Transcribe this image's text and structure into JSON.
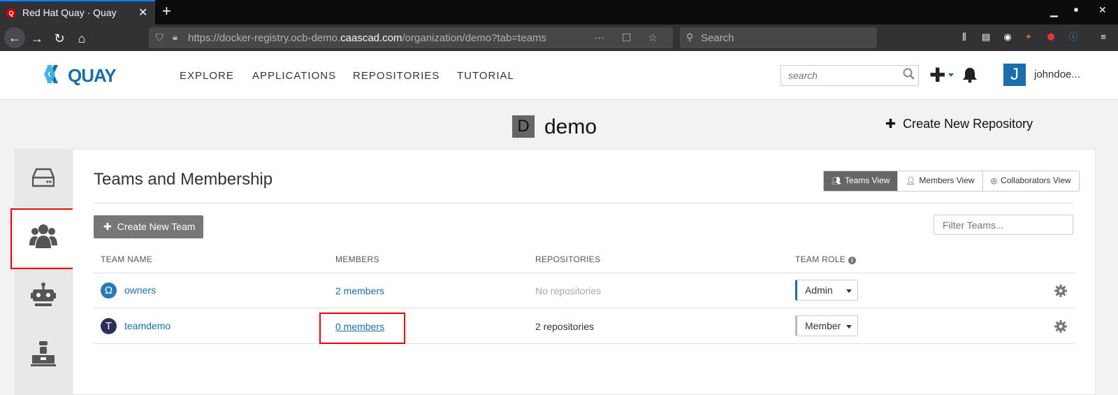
{
  "browser": {
    "tab_title": "Red Hat Quay · Quay",
    "url_prefix": "https://docker-registry.ocb-demo.",
    "url_domain": "caascad.com",
    "url_path": "/organization/demo?tab=teams",
    "search_placeholder": "Search",
    "favicon_letter": "Q"
  },
  "header": {
    "logo_text": "QUAY",
    "nav": [
      "EXPLORE",
      "APPLICATIONS",
      "REPOSITORIES",
      "TUTORIAL"
    ],
    "search_placeholder": "search",
    "user_initial": "J",
    "username": "johndoe..."
  },
  "org": {
    "initial": "D",
    "name": "demo",
    "create_repo_label": "Create New Repository"
  },
  "side_tabs": [
    "repositories-icon",
    "teams-icon",
    "robot-icon",
    "admin-icon"
  ],
  "panel": {
    "title": "Teams and Membership",
    "views": [
      {
        "label": "Teams View",
        "active": true
      },
      {
        "label": "Members View",
        "active": false
      },
      {
        "label": "Collaborators View",
        "active": false
      }
    ],
    "create_team_label": "Create New Team",
    "filter_placeholder": "Filter Teams...",
    "columns": [
      "TEAM NAME",
      "MEMBERS",
      "REPOSITORIES",
      "TEAM ROLE"
    ],
    "teams": [
      {
        "avatar": "Ω",
        "avatar_color": "#2a7ab8",
        "name": "owners",
        "members": "2 members",
        "repos": "No repositories",
        "role": "Admin"
      },
      {
        "avatar": "T",
        "avatar_color": "#2e2e5e",
        "name": "teamdemo",
        "members": "0 members",
        "repos": "2 repositories",
        "role": "Member"
      }
    ]
  },
  "colors": {
    "accent": "#1a6fab",
    "highlight": "#ee0000"
  }
}
